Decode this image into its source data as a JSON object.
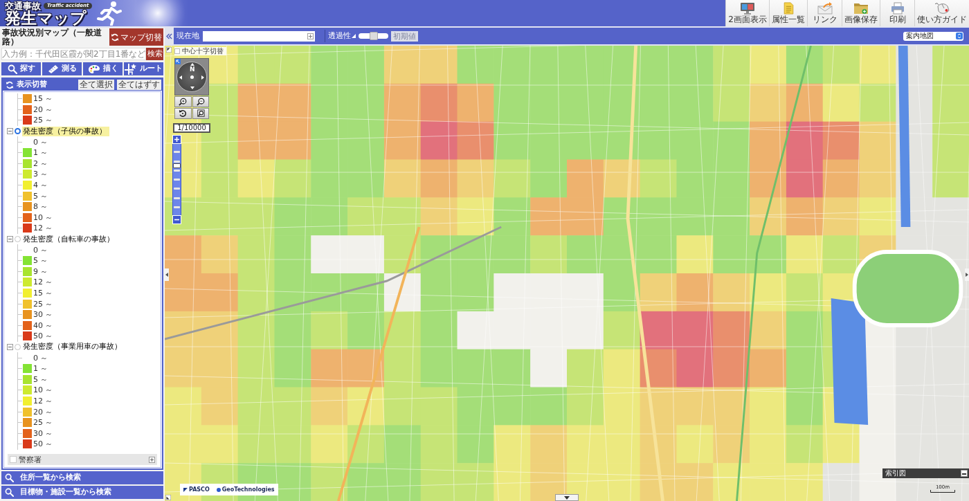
{
  "header": {
    "logo": {
      "title": "交通事故",
      "tag": "Traffic accident",
      "subtitle": "発生マップ"
    },
    "tools": [
      {
        "kind": "dual",
        "label": "2画面表示"
      },
      {
        "kind": "list",
        "label": "属性一覧"
      },
      {
        "kind": "link",
        "label": "リンク"
      },
      {
        "kind": "save",
        "label": "画像保存"
      },
      {
        "kind": "print",
        "label": "印刷"
      },
      {
        "kind": "guide",
        "label": "使い方ガイド"
      }
    ]
  },
  "sidebar": {
    "title": "事故状況別マップ（一般道路）",
    "map_switch": "マップ切替",
    "search": {
      "placeholder": "入力例：千代田区霞が関2丁目1番など",
      "button": "検索"
    },
    "tools": [
      {
        "kind": "search",
        "label": "探す"
      },
      {
        "kind": "measure",
        "label": "測る"
      },
      {
        "kind": "draw",
        "label": "描く"
      },
      {
        "kind": "route",
        "label": "ルート"
      }
    ],
    "layer_panel": {
      "title": "表示切替",
      "select_all": "全て選択",
      "clear_all": "全てはずす",
      "groups": [
        {
          "items": [
            {
              "label": "15 ～",
              "color": "#e8931f"
            },
            {
              "label": "20 ～",
              "color": "#e3621b"
            },
            {
              "label": "25 ～",
              "color": "#d93a1a"
            }
          ]
        },
        {
          "label": "発生密度（子供の事故）",
          "selected": true,
          "expanded": true,
          "items": [
            {
              "label": "0 ～"
            },
            {
              "label": "1 ～",
              "color": "#84e334"
            },
            {
              "label": "2 ～",
              "color": "#a8e42f"
            },
            {
              "label": "3 ～",
              "color": "#cdea2f"
            },
            {
              "label": "4 ～",
              "color": "#f1ef30"
            },
            {
              "label": "5 ～",
              "color": "#f0c12c"
            },
            {
              "label": "8 ～",
              "color": "#e8931f"
            },
            {
              "label": "10 ～",
              "color": "#e3621b"
            },
            {
              "label": "12 ～",
              "color": "#d93a1a"
            }
          ]
        },
        {
          "label": "発生密度（自転車の事故）",
          "selected": false,
          "expanded": true,
          "items": [
            {
              "label": "0 ～"
            },
            {
              "label": "5 ～",
              "color": "#84e334"
            },
            {
              "label": "9 ～",
              "color": "#a8e42f"
            },
            {
              "label": "12 ～",
              "color": "#cdea2f"
            },
            {
              "label": "15 ～",
              "color": "#f1ef30"
            },
            {
              "label": "25 ～",
              "color": "#f0c12c"
            },
            {
              "label": "30 ～",
              "color": "#e8931f"
            },
            {
              "label": "40 ～",
              "color": "#e3621b"
            },
            {
              "label": "50 ～",
              "color": "#d93a1a"
            }
          ]
        },
        {
          "label": "発生密度（事業用車の事故）",
          "selected": false,
          "expanded": true,
          "items": [
            {
              "label": "0 ～"
            },
            {
              "label": "1 ～",
              "color": "#84e334"
            },
            {
              "label": "5 ～",
              "color": "#a8e42f"
            },
            {
              "label": "10 ～",
              "color": "#cdea2f"
            },
            {
              "label": "12 ～",
              "color": "#f1ef30"
            },
            {
              "label": "20 ～",
              "color": "#f0c12c"
            },
            {
              "label": "25 ～",
              "color": "#e8931f"
            },
            {
              "label": "30 ～",
              "color": "#e3621b"
            },
            {
              "label": "50 ～",
              "color": "#d93a1a"
            }
          ]
        }
      ],
      "police": {
        "label": "警察署",
        "checked": false,
        "expanded": false
      }
    },
    "bottom_buttons": [
      "住所一覧から検索",
      "目標物・施設一覧から検索"
    ]
  },
  "map_toolbar": {
    "location_label": "現在地",
    "transparency": {
      "label": "透過性",
      "level": 0.5
    },
    "reset": {
      "label": "初期値",
      "disabled": true
    },
    "map_type": "案内地図"
  },
  "map": {
    "crosshair": {
      "label": "中心十字切替",
      "checked": false
    },
    "compass": "N",
    "scale": "1/10000",
    "zoom": {
      "level": 0.71
    },
    "credits": [
      "PASCO",
      "GeoTechnologies"
    ],
    "index_map": "索引図",
    "scale_bar": "100m"
  }
}
